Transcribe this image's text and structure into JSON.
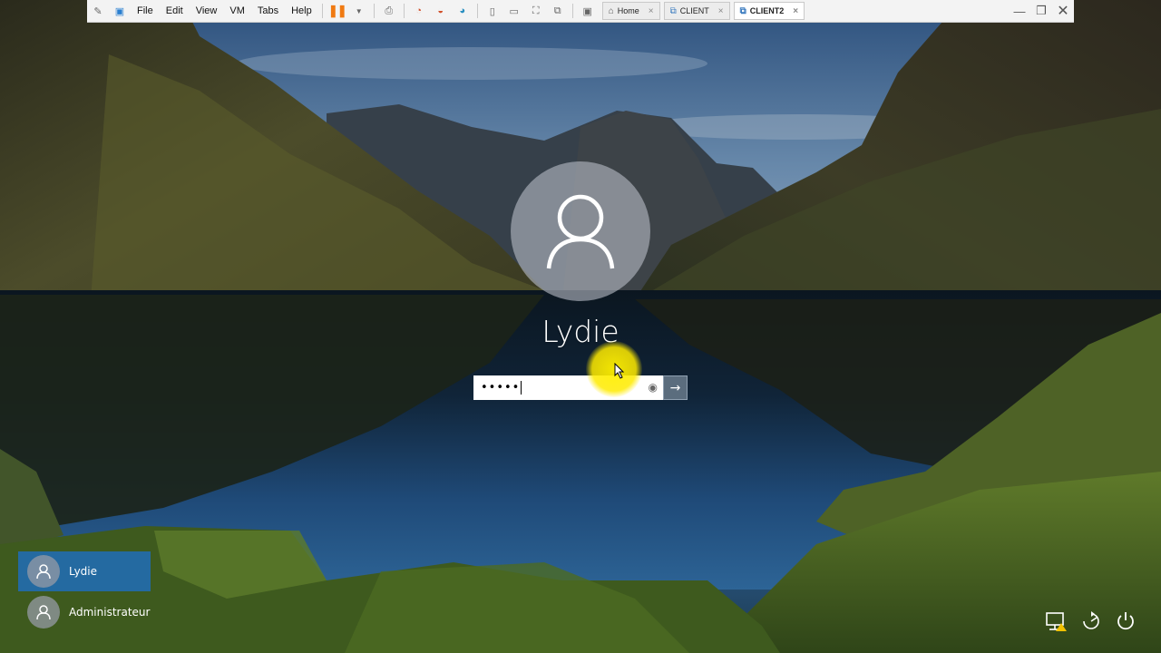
{
  "vm_toolbar": {
    "menus": [
      "File",
      "Edit",
      "View",
      "VM",
      "Tabs",
      "Help"
    ],
    "tabs": [
      {
        "label": "Home",
        "icon": "home-icon",
        "active": false
      },
      {
        "label": "CLIENT",
        "icon": "vm-icon",
        "active": false
      },
      {
        "label": "CLIENT2",
        "icon": "vm-icon",
        "active": true
      }
    ],
    "pause_color": "#f07a12"
  },
  "login": {
    "username": "Lydie",
    "password_mask": "•••••",
    "reveal_icon": "eye-icon",
    "submit_icon": "arrow-right-icon"
  },
  "user_list": [
    {
      "name": "Lydie",
      "selected": true
    },
    {
      "name": "Administrateur",
      "selected": false
    }
  ],
  "system_icons": [
    "network-icon",
    "accessibility-icon",
    "power-icon"
  ],
  "colors": {
    "selected_user_bg": "#1e6ebe",
    "cursor_highlight": "#ffeb00",
    "submit_button_bg": "#5b6d7e"
  }
}
